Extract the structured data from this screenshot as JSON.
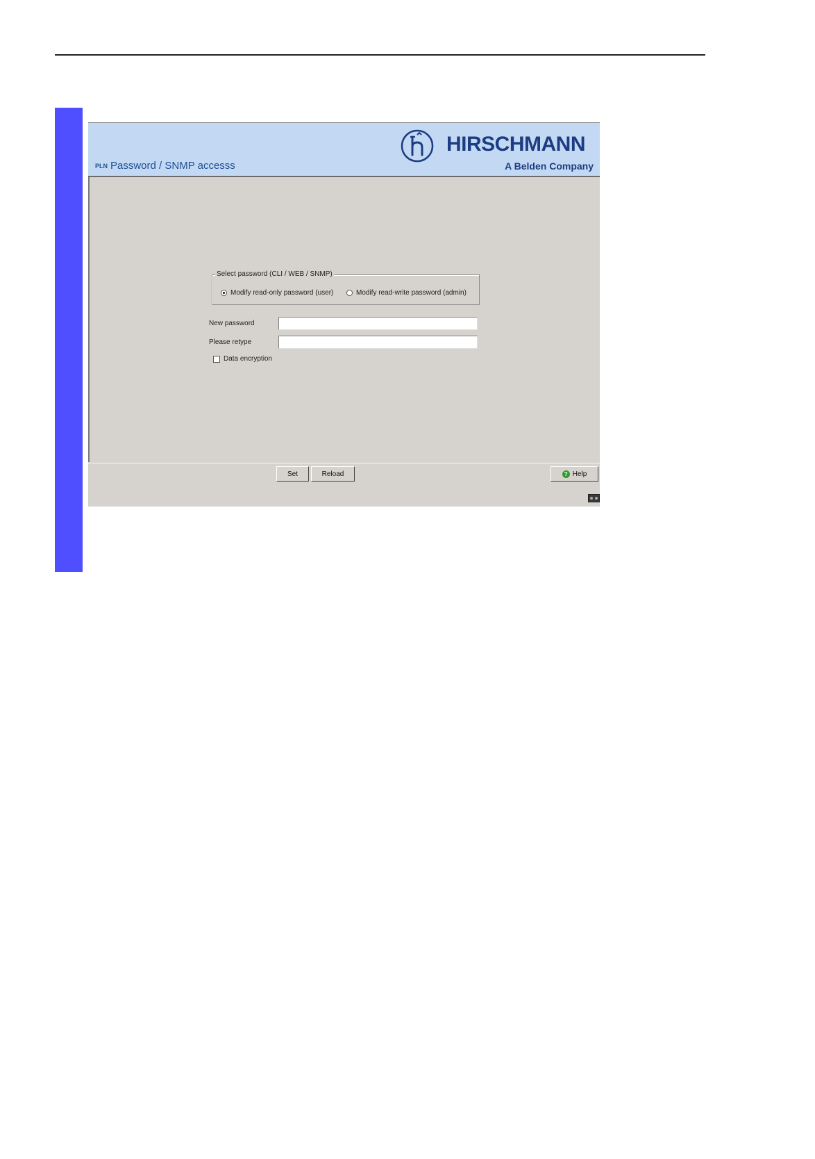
{
  "header": {
    "page_title": "Password / SNMP accesss",
    "title_icon_text": "PLN",
    "brand_name": "HIRSCHMANN",
    "brand_tagline": "A Belden Company"
  },
  "form": {
    "group_legend": "Select password  (CLI / WEB / SNMP)",
    "radio_options": [
      {
        "label": "Modify read-only password (user)",
        "checked": true
      },
      {
        "label": "Modify read-write password (admin)",
        "checked": false
      }
    ],
    "new_password_label": "New password",
    "new_password_value": "",
    "retype_label": "Please retype",
    "retype_value": "",
    "data_encryption_label": "Data encryption",
    "data_encryption_checked": false
  },
  "footer": {
    "set_label": "Set",
    "reload_label": "Reload",
    "help_label": "Help"
  },
  "colors": {
    "header_bg": "#c3d9f3",
    "brand": "#1c3d82",
    "panel_bg": "#d6d3ce",
    "side_bar": "#4f4fff"
  },
  "icons": {
    "title_icon": "pln-icon",
    "logo": "hirschmann-logo-icon",
    "help": "help-icon",
    "status": "status-indicator-icon"
  }
}
